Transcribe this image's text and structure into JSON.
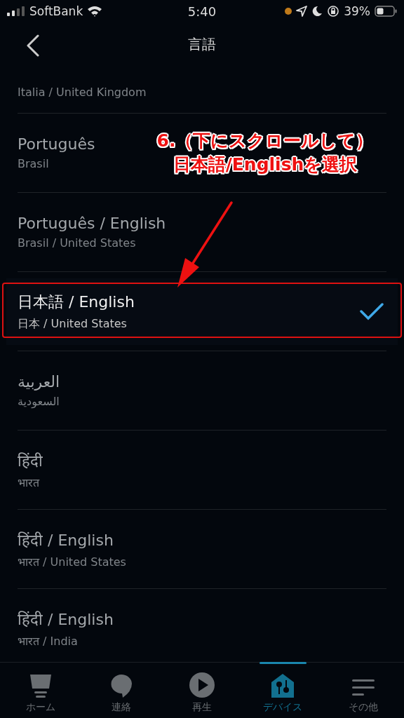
{
  "status_bar": {
    "carrier": "SoftBank",
    "time": "5:40",
    "battery": "39%"
  },
  "header": {
    "title": "言語"
  },
  "languages": [
    {
      "region": "Italia / United Kingdom",
      "selected": false
    },
    {
      "name": "Português",
      "region": "Brasil",
      "selected": false
    },
    {
      "name": "Português / English",
      "region": "Brasil / United States",
      "selected": false
    },
    {
      "name": "日本語 / English",
      "region": "日本 / United States",
      "selected": true
    },
    {
      "name": "العربية",
      "region": "السعودية",
      "selected": false
    },
    {
      "name": "हिंदी",
      "region": "भारत",
      "selected": false
    },
    {
      "name": "हिंदी / English",
      "region": "भारत / United States",
      "selected": false
    },
    {
      "name": "हिंदी / English",
      "region": "भारत / India",
      "selected": false
    }
  ],
  "annotation": {
    "lines": [
      "6.（下にスクロールして）",
      "日本語/Englishを選択"
    ]
  },
  "nav": [
    {
      "label": "ホーム",
      "kind": "home",
      "selected": false
    },
    {
      "label": "連絡",
      "kind": "chat",
      "selected": false
    },
    {
      "label": "再生",
      "kind": "play",
      "selected": false
    },
    {
      "label": "デバイス",
      "kind": "devices",
      "selected": true
    },
    {
      "label": "その他",
      "kind": "more",
      "selected": false
    }
  ]
}
